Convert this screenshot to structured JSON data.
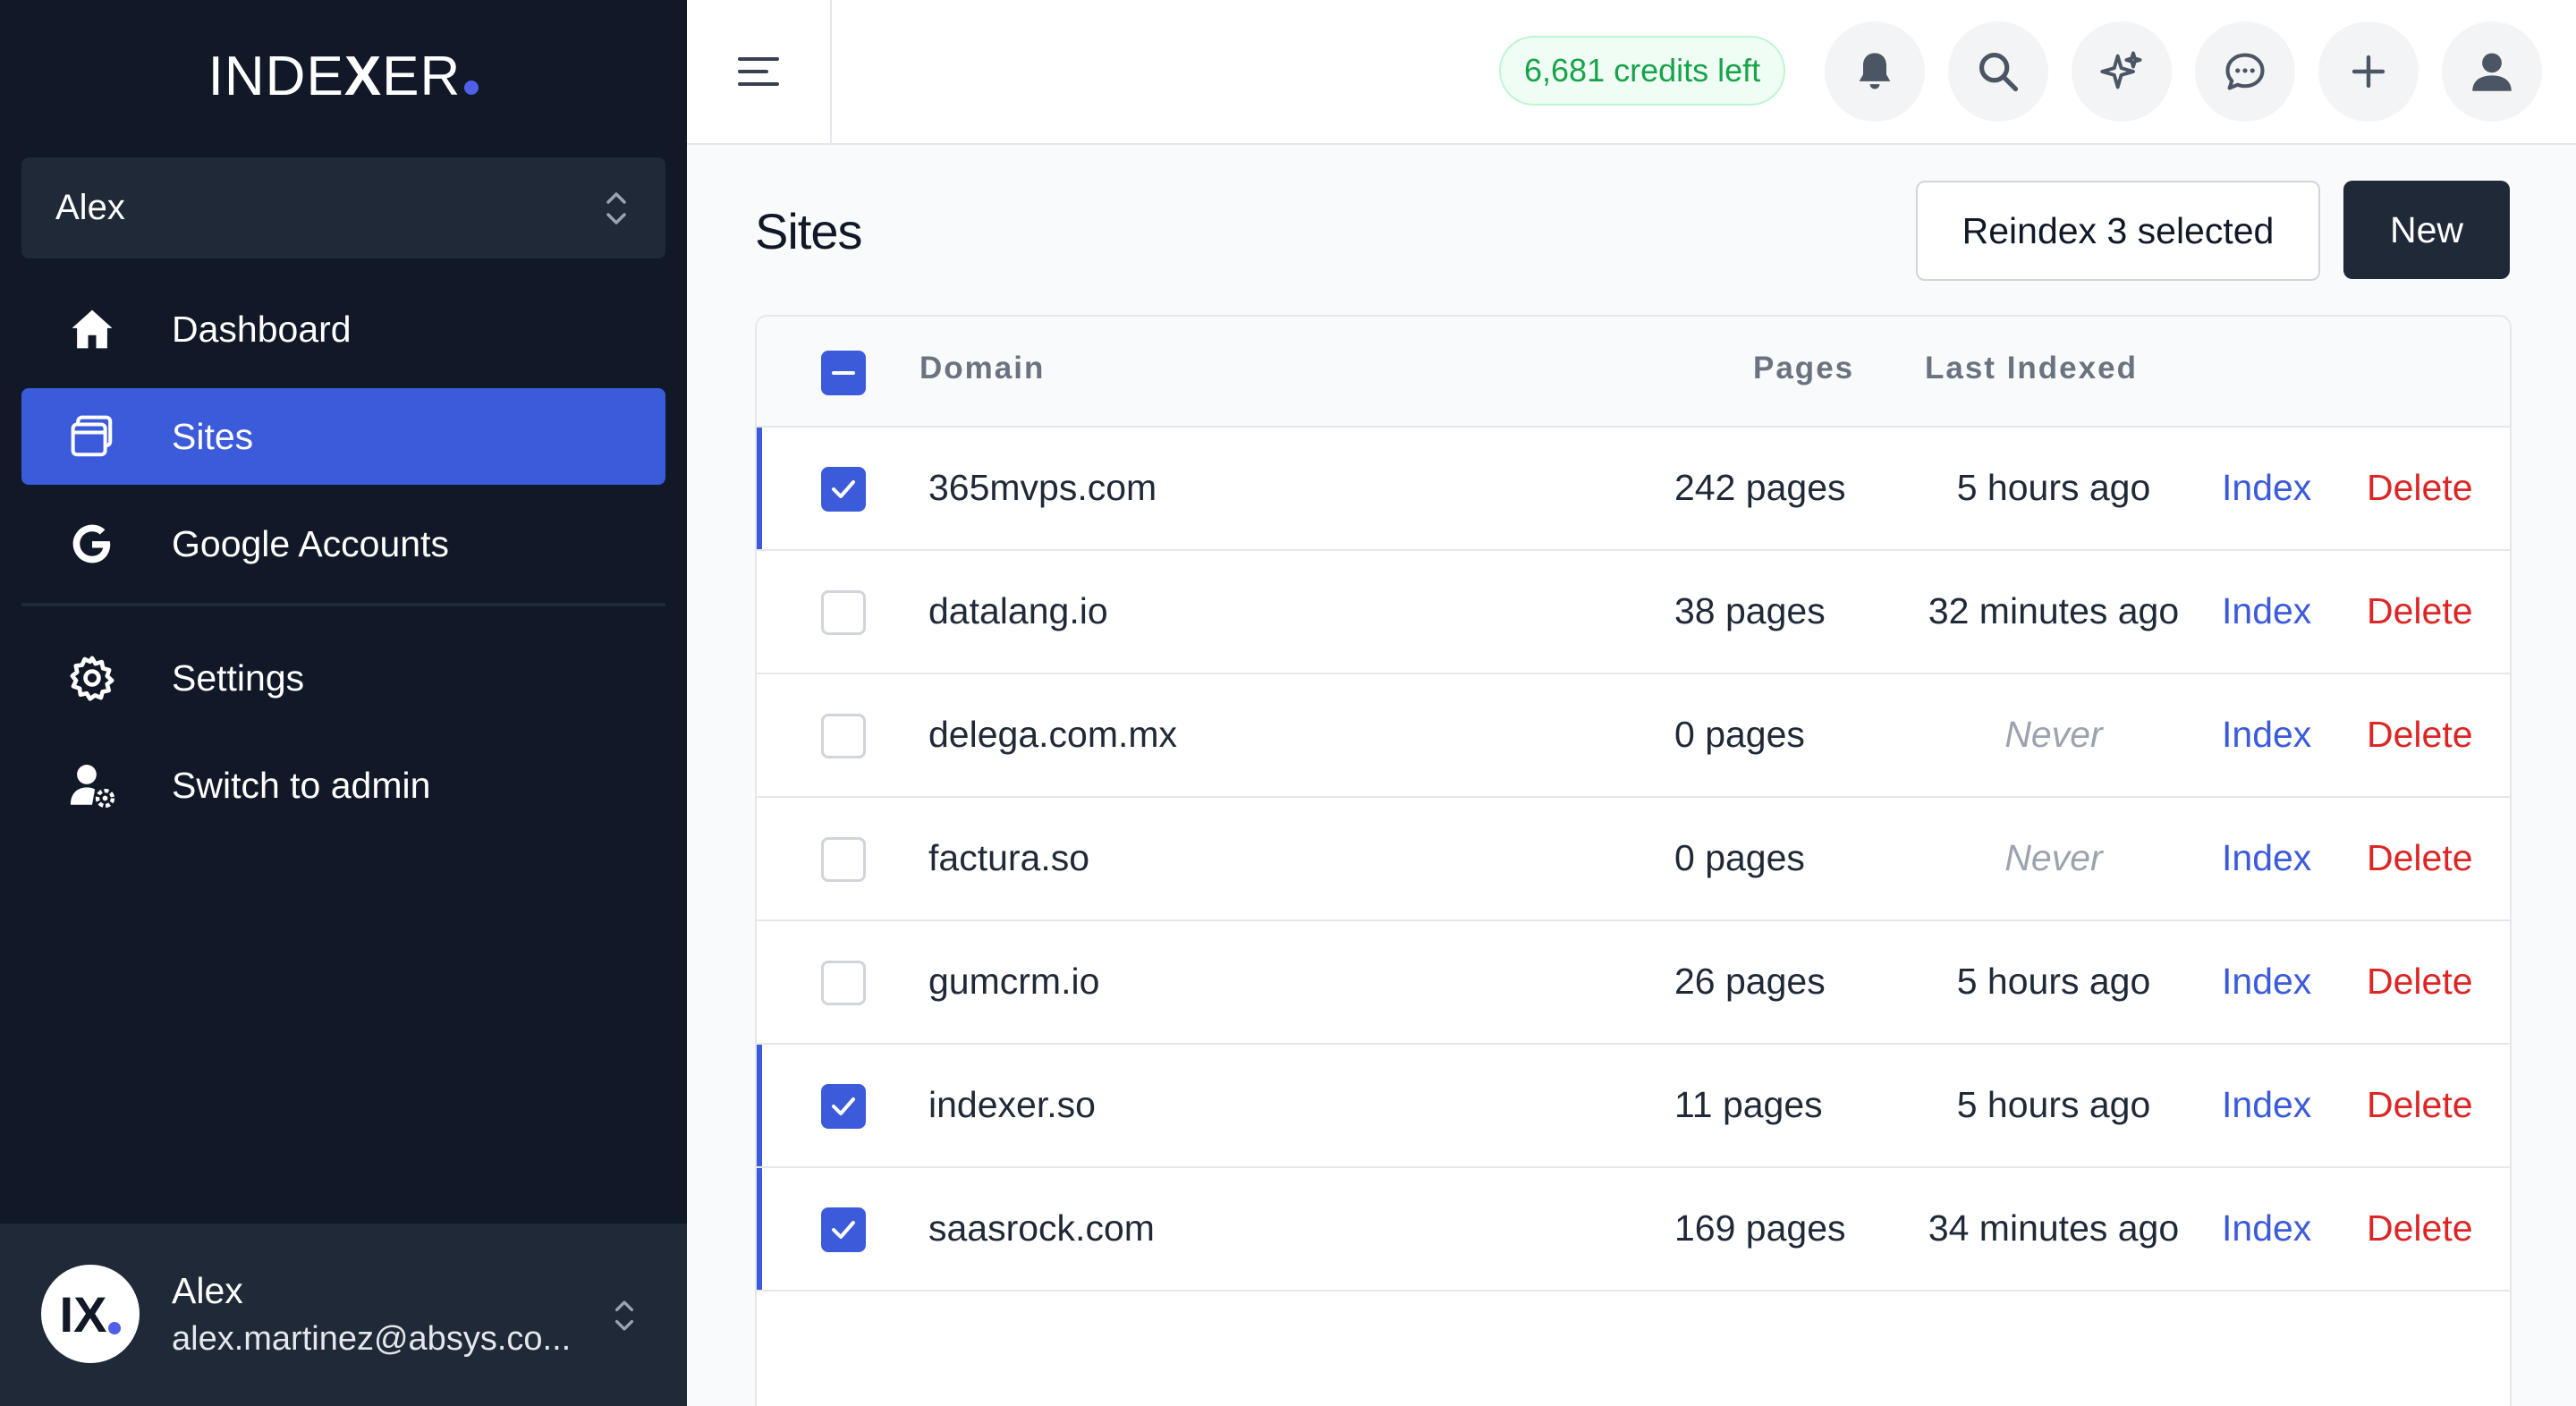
{
  "sidebar": {
    "logo": {
      "pre": "INDE",
      "x": "X",
      "post": "ER"
    },
    "account_selector": "Alex",
    "items": [
      {
        "label": "Dashboard",
        "icon": "home-icon"
      },
      {
        "label": "Sites",
        "icon": "browser-windows-icon"
      },
      {
        "label": "Google Accounts",
        "icon": "google-icon"
      },
      {
        "label": "Settings",
        "icon": "gear-icon"
      },
      {
        "label": "Switch to admin",
        "icon": "user-cog-icon"
      }
    ],
    "user": {
      "avatar_text": "IX",
      "name": "Alex",
      "email": "alex.martinez@absys.co..."
    }
  },
  "topbar": {
    "credits": "6,681 credits left",
    "icons": [
      "bell-icon",
      "search-icon",
      "sparkles-icon",
      "chat-icon",
      "plus-icon",
      "user-icon"
    ]
  },
  "main": {
    "title": "Sites",
    "reindex_label": "Reindex 3 selected",
    "new_label": "New",
    "table": {
      "headers": {
        "domain": "Domain",
        "pages": "Pages",
        "last": "Last Indexed"
      },
      "action_index": "Index",
      "action_delete": "Delete",
      "rows": [
        {
          "domain": "365mvps.com",
          "pages": "242 pages",
          "last": "5 hours ago",
          "checked": true
        },
        {
          "domain": "datalang.io",
          "pages": "38 pages",
          "last": "32 minutes ago",
          "checked": false
        },
        {
          "domain": "delega.com.mx",
          "pages": "0 pages",
          "last": "Never",
          "checked": false
        },
        {
          "domain": "factura.so",
          "pages": "0 pages",
          "last": "Never",
          "checked": false
        },
        {
          "domain": "gumcrm.io",
          "pages": "26 pages",
          "last": "5 hours ago",
          "checked": false
        },
        {
          "domain": "indexer.so",
          "pages": "11 pages",
          "last": "5 hours ago",
          "checked": true
        },
        {
          "domain": "saasrock.com",
          "pages": "169 pages",
          "last": "34 minutes ago",
          "checked": true
        }
      ]
    }
  },
  "colors": {
    "sidebar_bg": "#111827",
    "accent": "#3b5bdb",
    "danger": "#dc2626",
    "success": "#16a34a"
  }
}
